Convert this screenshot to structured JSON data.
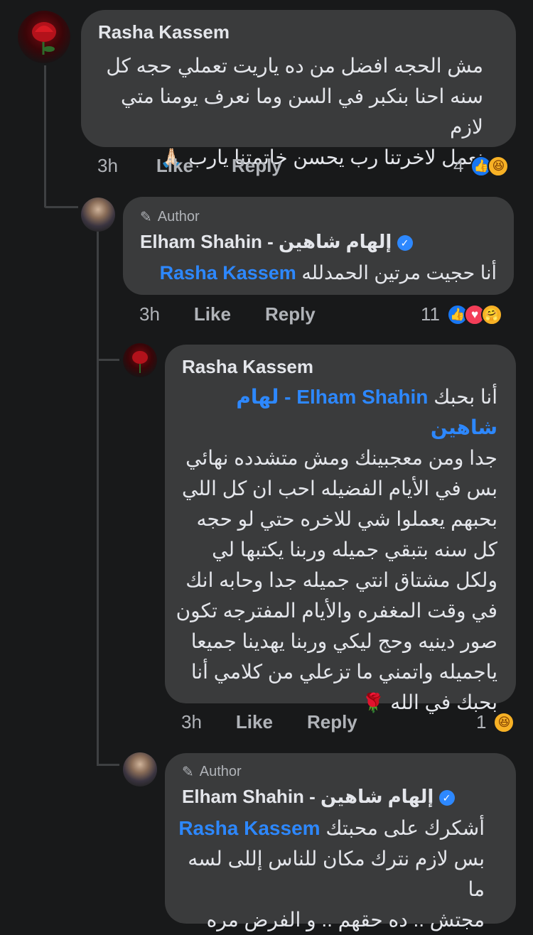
{
  "comments": [
    {
      "author": "Rasha Kassem",
      "text_lines": [
        "مش الحجه افضل من ده ياريت تعملي حجه كل",
        "سنه احنا بنكبر في السن وما نعرف يومنا متي لازم",
        "نعمل لاخرتنا رب يحسن خاتمتنا يارب"
      ],
      "emoji": "🙏🏻",
      "time": "3h",
      "like": "Like",
      "reply": "Reply",
      "react_count": "4",
      "reactions": [
        "like",
        "haha"
      ]
    },
    {
      "author_badge": "Author",
      "author": "Elham Shahin - إلهام شاهين",
      "mention": "Rasha Kassem",
      "text": "أنا حجيت مرتين  الحمدلله",
      "time": "3h",
      "like": "Like",
      "reply": "Reply",
      "react_count": "11",
      "reactions": [
        "like",
        "love",
        "care"
      ]
    },
    {
      "author": "Rasha Kassem",
      "mention": "Elham Shahin - لهام شاهين",
      "first_line_text": "أنا بحبك",
      "text_lines": [
        "جدا ومن معجبينك ومش متشدده نهائي",
        "بس في الأيام الفضيله احب ان كل اللي",
        "بحبهم يعملوا شي للاخره حتي لو حجه",
        "كل سنه بتبقي جميله وربنا يكتبها لي",
        "ولكل مشتاق انتي جميله جدا وحابه انك",
        "في وقت المغفره والأيام المفترجه تكون",
        "صور دينيه وحج ليكي وربنا يهدينا جميعا",
        "ياجميله واتمني ما تزعلي من كلامي أنا",
        "بحبك في الله"
      ],
      "emoji": "🌹",
      "time": "3h",
      "like": "Like",
      "reply": "Reply",
      "react_count": "1",
      "reactions": [
        "haha"
      ]
    },
    {
      "author_badge": "Author",
      "author": "Elham Shahin - إلهام شاهين",
      "mention": "Rasha Kassem",
      "first_line_text": "أشكرك على محبتك",
      "text_lines": [
        "بس لازم نترك مكان للناس إللى لسه ما",
        "مجتش .. ده حقهم .. و الفرض مره"
      ]
    }
  ],
  "colors": {
    "background": "#18191a",
    "bubble": "#3a3b3c",
    "mention": "#2d88ff",
    "secondary_text": "#b0b3b8"
  }
}
